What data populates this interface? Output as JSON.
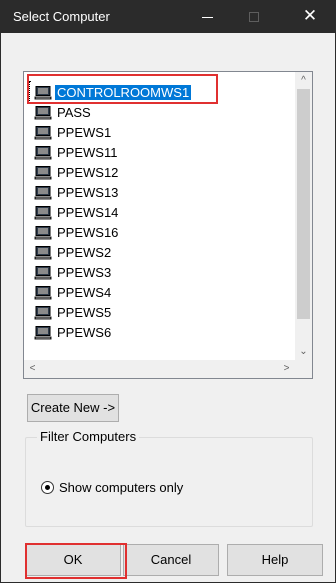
{
  "window": {
    "title": "Select Computer",
    "close_glyph": "✕"
  },
  "computer_list": {
    "items": [
      {
        "label": "CONTROLROOMWS1",
        "selected": true
      },
      {
        "label": "PASS"
      },
      {
        "label": "PPEWS1"
      },
      {
        "label": "PPEWS11"
      },
      {
        "label": "PPEWS12"
      },
      {
        "label": "PPEWS13"
      },
      {
        "label": "PPEWS14"
      },
      {
        "label": "PPEWS16"
      },
      {
        "label": "PPEWS2"
      },
      {
        "label": "PPEWS3"
      },
      {
        "label": "PPEWS4"
      },
      {
        "label": "PPEWS5"
      },
      {
        "label": "PPEWS6"
      }
    ],
    "item_icon": "computer-icon"
  },
  "scrollbars": {
    "up": "^",
    "down": "⌄",
    "left": "<",
    "right": ">"
  },
  "actions": {
    "create_new_label": "Create New ->",
    "ok_label": "OK",
    "cancel_label": "Cancel",
    "help_label": "Help"
  },
  "filter": {
    "group_label": "Filter Computers",
    "option_label": "Show computers only",
    "option_checked": true
  },
  "colors": {
    "titlebar": "#2b2b2b",
    "selection": "#0078d7",
    "highlight": "#e03030"
  }
}
